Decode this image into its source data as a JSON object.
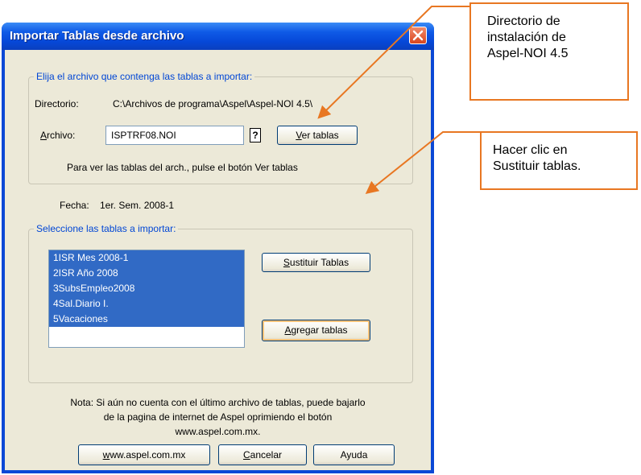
{
  "window": {
    "title": "Importar Tablas desde archivo"
  },
  "file_group": {
    "legend": "Elija el archivo que contenga las tablas a importar:",
    "directory_label": "Directorio:",
    "directory_value": "C:\\Archivos de programa\\Aspel\\Aspel-NOI 4.5\\",
    "file_label": "Archivo:",
    "file_value": "ISPTRF08.NOI",
    "help_glyph": "?",
    "view_button": "Ver tablas",
    "hint": "Para ver las tablas del arch., pulse el botón Ver tablas"
  },
  "date": {
    "label": "Fecha:",
    "value": "1er. Sem. 2008-1"
  },
  "tables_group": {
    "legend": "Seleccione las tablas a importar:",
    "items": [
      "1ISR Mes 2008-1",
      "2ISR Año 2008",
      "3SubsEmpleo2008",
      "4Sal.Diario I.",
      "5Vacaciones"
    ],
    "replace_button": "Sustituir Tablas",
    "add_button": "Agregar tablas"
  },
  "note": {
    "line1": "Nota: Si aún no cuenta con el último archivo de tablas, puede bajarlo",
    "line2": "de la pagina de internet de Aspel oprimiendo el botón",
    "line3": "www.aspel.com.mx."
  },
  "footer": {
    "web_button": "www.aspel.com.mx",
    "cancel_button": "Cancelar",
    "help_button": "Ayuda"
  },
  "callouts": {
    "directory_line1": "Directorio de",
    "directory_line2": "instalación de",
    "directory_line3": "Aspel-NOI 4.5",
    "replace_line1": "Hacer clic en",
    "replace_line2": "Sustituir tablas."
  },
  "colors": {
    "callout_border": "#e87722",
    "selection": "#316ac5",
    "legend_text": "#0046d5"
  }
}
